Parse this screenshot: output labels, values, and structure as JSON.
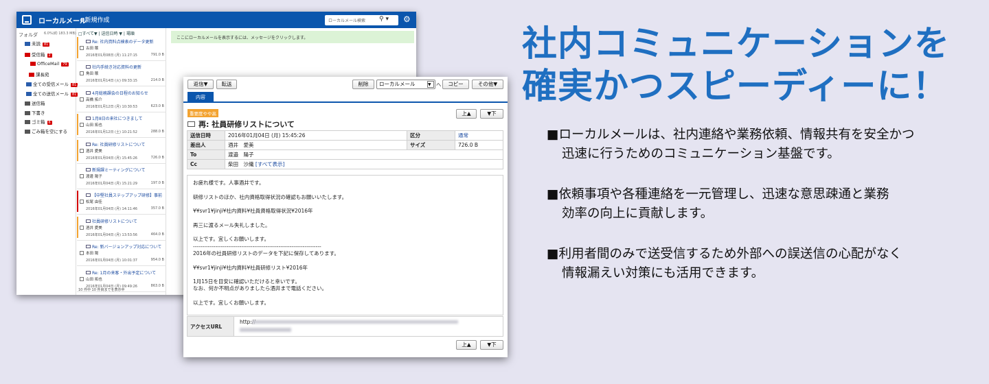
{
  "headline": {
    "line1": "社内コミュニケーションを",
    "line2": "確実かつスピーディーに！"
  },
  "bullets": [
    {
      "line1": "■ローカルメールは、社内連絡や業務依頼、情報共有を安全かつ",
      "line2": "迅速に行うためのコミュニケーション基盤です。"
    },
    {
      "line1": "■依頼事項や各種連絡を一元管理し、迅速な意思疎通と業務",
      "line2": "効率の向上に貢献します。"
    },
    {
      "line1": "■利用者間のみで送受信するため外部への誤送信の心配がなく",
      "line2": "情報漏えい対策にも活用できます。"
    }
  ],
  "mail_app": {
    "title": "ローカルメール",
    "new_mail": "⊕新規作成",
    "search_placeholder": "ローカルメール検索",
    "folder_header": "フォルダ",
    "storage": "6.0%(約 183.3 MB)",
    "folders": [
      {
        "label": "未読",
        "badge": "81",
        "color": "#2a5dab"
      },
      {
        "label": "受信箱",
        "badge": "2",
        "color": "#d40000"
      },
      {
        "label": "OfficeMail",
        "badge": "79",
        "color": "#d40000"
      },
      {
        "label": "課長宛",
        "badge": "",
        "color": "#d40000"
      },
      {
        "label": "全ての受信メール",
        "badge": "81",
        "color": "#2a5dab"
      },
      {
        "label": "全ての送信メール",
        "badge": "81",
        "color": "#2a5dab"
      },
      {
        "label": "送信箱",
        "badge": "",
        "color": "#555555"
      },
      {
        "label": "下書き",
        "badge": "",
        "color": "#555555"
      },
      {
        "label": "ゴミ箱",
        "badge": "6",
        "color": "#555555"
      },
      {
        "label": "ごみ箱を空にする",
        "badge": "",
        "color": "#555555"
      }
    ],
    "list_header": "□すべて▼ | 送信日時 ▼ | 場順",
    "hint": "ここにローカルメールを表示するには、メッセージをクリックします。",
    "messages": [
      {
        "subject": "Re: 社内資料点検表のデータ更新",
        "from": "古田 穣",
        "date": "2016年01月08日 (月) 11:27:15",
        "size": "791.0 B",
        "flag": "#f3a330"
      },
      {
        "subject": "社内手続き対応資料の更新",
        "from": "角田 穣",
        "date": "2016年01月14日 (火) 09:33:15",
        "size": "214.0 B",
        "flag": ""
      },
      {
        "subject": "4月総務課会の日程のお知らせ",
        "from": "高橋 拓介",
        "date": "2016年01月12日 (月) 10:30:53",
        "size": "623.0 B",
        "flag": ""
      },
      {
        "subject": "1月8日の来社につきまして",
        "from": "山田 拓也",
        "date": "2016年01月12日 (土) 10:21:52",
        "size": "288.0 B",
        "flag": "#f3a330"
      },
      {
        "subject": "Re: 社員研修リストについて",
        "from": "酒井 愛美",
        "date": "2016年01月04日 (月) 15:45:26",
        "size": "726.0 B",
        "flag": "#f3a330"
      },
      {
        "subject": "新規課ミーティングについて",
        "from": "渡邊 陽子",
        "date": "2016年01月04日 (月) 15:21:29",
        "size": "197.0 B",
        "flag": ""
      },
      {
        "subject": "【中堅社員ステップアップ研修】事前",
        "from": "松尾 由佳",
        "date": "2016年01月04日 (月) 14:11:46",
        "size": "357.0 B",
        "flag": "#d40000"
      },
      {
        "subject": "社員研修リストについて",
        "from": "酒井 愛美",
        "date": "2016年01月04日 (月) 13:53:56",
        "size": "464.0 B",
        "flag": "#f3a330"
      },
      {
        "subject": "Re: 新バージョンアップ対応について",
        "from": "本田 陽",
        "date": "2016年01月04日 (月) 10:01:37",
        "size": "954.0 B",
        "flag": ""
      },
      {
        "subject": "Re: 1月の来客・外出予定について",
        "from": "山田 拓也",
        "date": "2016年01月04日 (月) 09:49:26",
        "size": "863.0 B",
        "flag": ""
      }
    ],
    "list_footer": "10 件中 10 件目までを表示中"
  },
  "mail_view": {
    "toolbar": {
      "reply": "返信▼",
      "forward": "転送",
      "delete": "削除",
      "folder_select": "ローカルメール",
      "move": "へ",
      "copy": "コピー",
      "other": "その他▼"
    },
    "tab": "内容",
    "priority": "重要度やや高",
    "up": "上▲",
    "down": "▼下",
    "subject": "再: 社員研修リストについて",
    "meta": {
      "sent_label": "送信日時",
      "sent": "2016年01月04日 (月) 15:45:26",
      "category_label": "区分",
      "category": "通常",
      "from_label": "差出人",
      "from": "酒井　愛美",
      "size_label": "サイズ",
      "size": "726.0 B",
      "to_label": "To",
      "to": "渡邉　陽子",
      "cc_label": "Cc",
      "cc": "柴田　沙織",
      "show_all": "[すべて表示]"
    },
    "body": [
      "お疲れ様です。人事酒井です。",
      "",
      "研修リストのほか、社内資格取得状況の確認もお願いいたします。",
      "",
      "¥¥svr1¥jinji¥社内資料¥社員資格取得状況¥2016年",
      "",
      "再三に渡るメール失礼しました。",
      "",
      "以上です。宜しくお願いします。",
      "---------------------------------------------------------------------",
      "2016年の社員研修リストのデータを下記に保存してあります。",
      "",
      "¥¥svr1¥jinji¥社内資料¥社員研修リスト¥2016年",
      "",
      "1月15日を目安に確認いただけると幸いです。",
      "なお、何か不明点がありましたら酒井まで電話ください。",
      "",
      "以上です。宜しくお願いします。"
    ],
    "access_url_label": "アクセスURL",
    "access_url": "http://"
  }
}
